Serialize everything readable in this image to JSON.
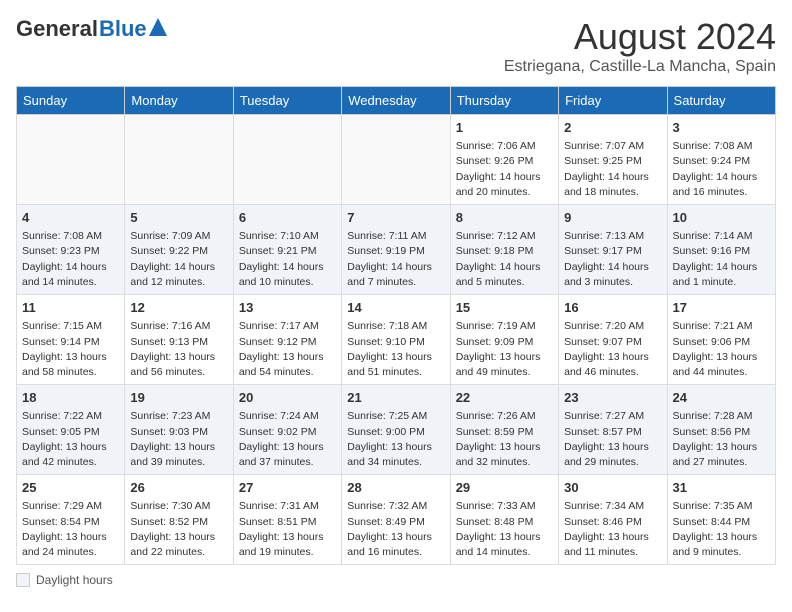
{
  "header": {
    "logo_general": "General",
    "logo_blue": "Blue",
    "title": "August 2024",
    "subtitle": "Estriegana, Castille-La Mancha, Spain"
  },
  "days_of_week": [
    "Sunday",
    "Monday",
    "Tuesday",
    "Wednesday",
    "Thursday",
    "Friday",
    "Saturday"
  ],
  "weeks": [
    [
      {
        "day": "",
        "info": ""
      },
      {
        "day": "",
        "info": ""
      },
      {
        "day": "",
        "info": ""
      },
      {
        "day": "",
        "info": ""
      },
      {
        "day": "1",
        "info": "Sunrise: 7:06 AM\nSunset: 9:26 PM\nDaylight: 14 hours and 20 minutes."
      },
      {
        "day": "2",
        "info": "Sunrise: 7:07 AM\nSunset: 9:25 PM\nDaylight: 14 hours and 18 minutes."
      },
      {
        "day": "3",
        "info": "Sunrise: 7:08 AM\nSunset: 9:24 PM\nDaylight: 14 hours and 16 minutes."
      }
    ],
    [
      {
        "day": "4",
        "info": "Sunrise: 7:08 AM\nSunset: 9:23 PM\nDaylight: 14 hours and 14 minutes."
      },
      {
        "day": "5",
        "info": "Sunrise: 7:09 AM\nSunset: 9:22 PM\nDaylight: 14 hours and 12 minutes."
      },
      {
        "day": "6",
        "info": "Sunrise: 7:10 AM\nSunset: 9:21 PM\nDaylight: 14 hours and 10 minutes."
      },
      {
        "day": "7",
        "info": "Sunrise: 7:11 AM\nSunset: 9:19 PM\nDaylight: 14 hours and 7 minutes."
      },
      {
        "day": "8",
        "info": "Sunrise: 7:12 AM\nSunset: 9:18 PM\nDaylight: 14 hours and 5 minutes."
      },
      {
        "day": "9",
        "info": "Sunrise: 7:13 AM\nSunset: 9:17 PM\nDaylight: 14 hours and 3 minutes."
      },
      {
        "day": "10",
        "info": "Sunrise: 7:14 AM\nSunset: 9:16 PM\nDaylight: 14 hours and 1 minute."
      }
    ],
    [
      {
        "day": "11",
        "info": "Sunrise: 7:15 AM\nSunset: 9:14 PM\nDaylight: 13 hours and 58 minutes."
      },
      {
        "day": "12",
        "info": "Sunrise: 7:16 AM\nSunset: 9:13 PM\nDaylight: 13 hours and 56 minutes."
      },
      {
        "day": "13",
        "info": "Sunrise: 7:17 AM\nSunset: 9:12 PM\nDaylight: 13 hours and 54 minutes."
      },
      {
        "day": "14",
        "info": "Sunrise: 7:18 AM\nSunset: 9:10 PM\nDaylight: 13 hours and 51 minutes."
      },
      {
        "day": "15",
        "info": "Sunrise: 7:19 AM\nSunset: 9:09 PM\nDaylight: 13 hours and 49 minutes."
      },
      {
        "day": "16",
        "info": "Sunrise: 7:20 AM\nSunset: 9:07 PM\nDaylight: 13 hours and 46 minutes."
      },
      {
        "day": "17",
        "info": "Sunrise: 7:21 AM\nSunset: 9:06 PM\nDaylight: 13 hours and 44 minutes."
      }
    ],
    [
      {
        "day": "18",
        "info": "Sunrise: 7:22 AM\nSunset: 9:05 PM\nDaylight: 13 hours and 42 minutes."
      },
      {
        "day": "19",
        "info": "Sunrise: 7:23 AM\nSunset: 9:03 PM\nDaylight: 13 hours and 39 minutes."
      },
      {
        "day": "20",
        "info": "Sunrise: 7:24 AM\nSunset: 9:02 PM\nDaylight: 13 hours and 37 minutes."
      },
      {
        "day": "21",
        "info": "Sunrise: 7:25 AM\nSunset: 9:00 PM\nDaylight: 13 hours and 34 minutes."
      },
      {
        "day": "22",
        "info": "Sunrise: 7:26 AM\nSunset: 8:59 PM\nDaylight: 13 hours and 32 minutes."
      },
      {
        "day": "23",
        "info": "Sunrise: 7:27 AM\nSunset: 8:57 PM\nDaylight: 13 hours and 29 minutes."
      },
      {
        "day": "24",
        "info": "Sunrise: 7:28 AM\nSunset: 8:56 PM\nDaylight: 13 hours and 27 minutes."
      }
    ],
    [
      {
        "day": "25",
        "info": "Sunrise: 7:29 AM\nSunset: 8:54 PM\nDaylight: 13 hours and 24 minutes."
      },
      {
        "day": "26",
        "info": "Sunrise: 7:30 AM\nSunset: 8:52 PM\nDaylight: 13 hours and 22 minutes."
      },
      {
        "day": "27",
        "info": "Sunrise: 7:31 AM\nSunset: 8:51 PM\nDaylight: 13 hours and 19 minutes."
      },
      {
        "day": "28",
        "info": "Sunrise: 7:32 AM\nSunset: 8:49 PM\nDaylight: 13 hours and 16 minutes."
      },
      {
        "day": "29",
        "info": "Sunrise: 7:33 AM\nSunset: 8:48 PM\nDaylight: 13 hours and 14 minutes."
      },
      {
        "day": "30",
        "info": "Sunrise: 7:34 AM\nSunset: 8:46 PM\nDaylight: 13 hours and 11 minutes."
      },
      {
        "day": "31",
        "info": "Sunrise: 7:35 AM\nSunset: 8:44 PM\nDaylight: 13 hours and 9 minutes."
      }
    ]
  ],
  "footer": {
    "box_label": "Daylight hours"
  }
}
